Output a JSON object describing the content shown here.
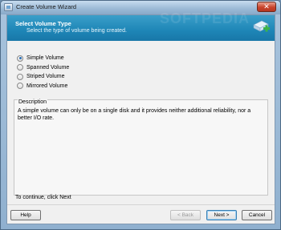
{
  "window": {
    "title": "Create Volume Wizard",
    "close_glyph": "✕"
  },
  "header": {
    "title": "Select Volume Type",
    "subtitle": "Select the type of volume being created.",
    "watermark": "SOFTPEDIA",
    "icon": "disk-plus-icon",
    "accent": "#1e86b7"
  },
  "options": [
    {
      "label": "Simple Volume",
      "checked": true
    },
    {
      "label": "Spanned Volume",
      "checked": false
    },
    {
      "label": "Striped Volume",
      "checked": false
    },
    {
      "label": "Mirrored Volume",
      "checked": false
    }
  ],
  "description": {
    "legend": "Description",
    "text": "A simple volume can only be on a single disk and it provides neither additional reliability, nor a better I/O rate."
  },
  "continue_text": "To continue, click Next",
  "buttons": {
    "help": "Help",
    "back": "< Back",
    "next": "Next >",
    "cancel": "Cancel"
  }
}
